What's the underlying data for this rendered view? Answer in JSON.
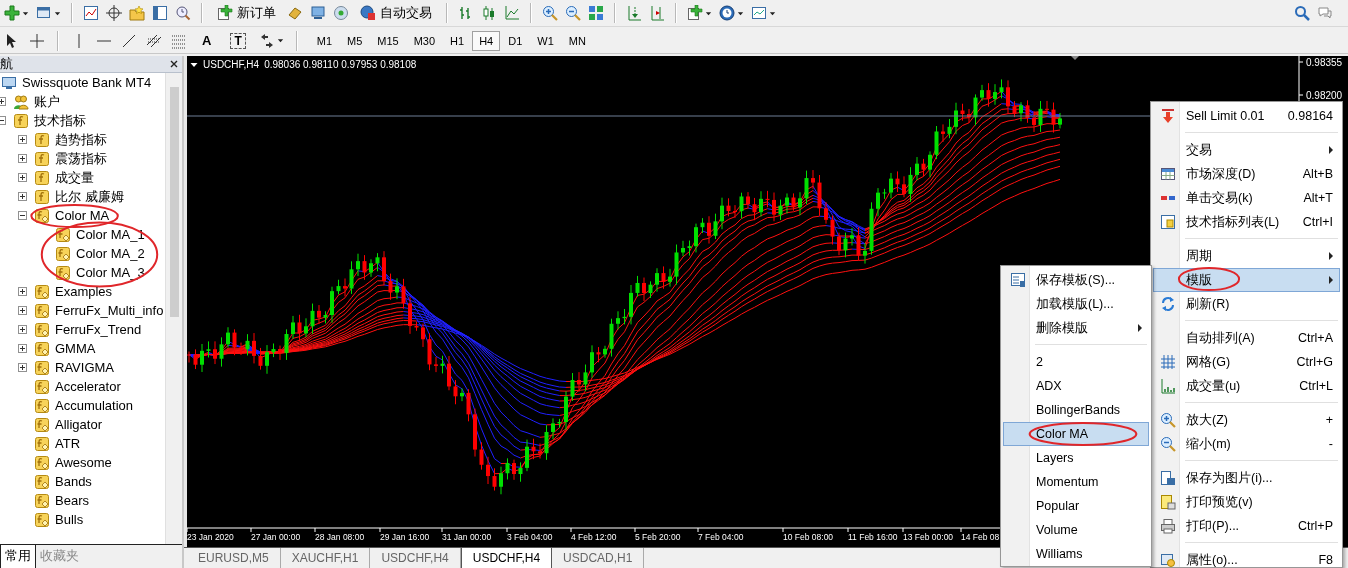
{
  "toolbar": {
    "new_order": "新订单",
    "auto_trading": "自动交易"
  },
  "drawing_toolbar": {
    "text_tool": "A",
    "label_tool": "T",
    "timeframes": [
      {
        "label": "M1",
        "selected": false
      },
      {
        "label": "M5",
        "selected": false
      },
      {
        "label": "M15",
        "selected": false
      },
      {
        "label": "M30",
        "selected": false
      },
      {
        "label": "H1",
        "selected": false
      },
      {
        "label": "H4",
        "selected": true
      },
      {
        "label": "D1",
        "selected": false
      },
      {
        "label": "W1",
        "selected": false
      },
      {
        "label": "MN",
        "selected": false
      }
    ]
  },
  "navigator": {
    "title": "航",
    "tree": [
      {
        "label": "Swissquote Bank MT4",
        "kind": "terminal",
        "circled": false,
        "children": [
          {
            "label": "账户",
            "kind": "accounts",
            "expanded": false,
            "circled": false
          },
          {
            "label": "技术指标",
            "kind": "folder",
            "expanded": true,
            "circled": false,
            "children": [
              {
                "label": "趋势指标",
                "kind": "folder",
                "expanded": false,
                "circled": false
              },
              {
                "label": "震荡指标",
                "kind": "folder",
                "expanded": false,
                "circled": false
              },
              {
                "label": "成交量",
                "kind": "folder",
                "expanded": false,
                "circled": false
              },
              {
                "label": "比尔 威廉姆",
                "kind": "folder",
                "expanded": false,
                "circled": false
              },
              {
                "label": "Color MA",
                "kind": "indicator",
                "expanded": true,
                "circled": true,
                "children_circled": true,
                "children": [
                  {
                    "label": "Color MA_1",
                    "kind": "indicator",
                    "circled": false
                  },
                  {
                    "label": "Color MA_2",
                    "kind": "indicator",
                    "circled": false
                  },
                  {
                    "label": "Color MA_3",
                    "kind": "indicator",
                    "circled": false
                  }
                ]
              },
              {
                "label": "Examples",
                "kind": "indicator",
                "expanded": false,
                "circled": false
              },
              {
                "label": "FerruFx_Multi_info",
                "kind": "indicator",
                "expanded": false,
                "circled": false
              },
              {
                "label": "FerruFx_Trend",
                "kind": "indicator",
                "expanded": false,
                "circled": false
              },
              {
                "label": "GMMA",
                "kind": "indicator",
                "expanded": false,
                "circled": false
              },
              {
                "label": "RAVIGMA",
                "kind": "indicator",
                "expanded": false,
                "circled": false
              },
              {
                "label": "Accelerator",
                "kind": "indicator",
                "circled": false
              },
              {
                "label": "Accumulation",
                "kind": "indicator",
                "circled": false
              },
              {
                "label": "Alligator",
                "kind": "indicator",
                "circled": false
              },
              {
                "label": "ATR",
                "kind": "indicator",
                "circled": false
              },
              {
                "label": "Awesome",
                "kind": "indicator",
                "circled": false
              },
              {
                "label": "Bands",
                "kind": "indicator",
                "circled": false
              },
              {
                "label": "Bears",
                "kind": "indicator",
                "circled": false
              },
              {
                "label": "Bulls",
                "kind": "indicator",
                "circled": false
              }
            ]
          }
        ]
      }
    ],
    "tabs": [
      {
        "label": "常用",
        "selected": true
      },
      {
        "label": "收藏夹",
        "selected": false
      }
    ]
  },
  "chart": {
    "symbol": "USDCHF,H4",
    "ohlc": "0.98036 0.98110 0.97953 0.98108",
    "price_labels": [
      "0.98355",
      "0.98200"
    ],
    "date_labels": [
      "23 Jan 2020",
      "27 Jan 00:00",
      "28 Jan 08:00",
      "29 Jan 16:00",
      "31 Jan 00:00",
      "3 Feb 04:00",
      "4 Feb 12:00",
      "5 Feb 20:00",
      "7 Feb 04:00",
      "10 Feb 08:00",
      "11 Feb 16:00",
      "13 Feb 00:00",
      "14 Feb 08"
    ]
  },
  "chart_tabs": [
    {
      "label": "EURUSD,M5",
      "selected": false
    },
    {
      "label": "XAUCHF,H1",
      "selected": false
    },
    {
      "label": "USDCHF,H4",
      "selected": false
    },
    {
      "label": "USDCHF,H4",
      "selected": true
    },
    {
      "label": "USDCAD,H1",
      "selected": false
    }
  ],
  "context_menu": {
    "items": [
      {
        "kind": "order",
        "label": "Sell Limit 0.01",
        "shortcut": "0.98164",
        "submenu": false,
        "selected": false,
        "circled": false
      },
      {
        "kind": "separator"
      },
      {
        "kind": "item",
        "label": "交易",
        "submenu": true,
        "selected": false,
        "circled": false
      },
      {
        "kind": "item",
        "label": "市场深度(D)",
        "shortcut": "Alt+B",
        "submenu": false,
        "selected": false,
        "circled": false
      },
      {
        "kind": "item",
        "label": "单击交易(k)",
        "shortcut": "Alt+T",
        "submenu": false,
        "selected": false,
        "circled": false
      },
      {
        "kind": "item",
        "label": "技术指标列表(L)",
        "shortcut": "Ctrl+I",
        "submenu": false,
        "selected": false,
        "circled": false
      },
      {
        "kind": "separator"
      },
      {
        "kind": "item",
        "label": "周期",
        "submenu": true,
        "selected": false,
        "circled": false
      },
      {
        "kind": "item",
        "label": "模版",
        "submenu": true,
        "selected": true,
        "circled": true
      },
      {
        "kind": "item",
        "label": "刷新(R)",
        "submenu": false,
        "selected": false,
        "circled": false
      },
      {
        "kind": "separator"
      },
      {
        "kind": "item",
        "label": "自动排列(A)",
        "shortcut": "Ctrl+A",
        "submenu": false,
        "selected": false,
        "circled": false
      },
      {
        "kind": "item",
        "label": "网格(G)",
        "shortcut": "Ctrl+G",
        "submenu": false,
        "selected": false,
        "circled": false
      },
      {
        "kind": "item",
        "label": "成交量(u)",
        "shortcut": "Ctrl+L",
        "submenu": false,
        "selected": false,
        "circled": false
      },
      {
        "kind": "separator"
      },
      {
        "kind": "item",
        "label": "放大(Z)",
        "shortcut": "+",
        "submenu": false,
        "selected": false,
        "circled": false
      },
      {
        "kind": "item",
        "label": "缩小(m)",
        "shortcut": "-",
        "submenu": false,
        "selected": false,
        "circled": false
      },
      {
        "kind": "separator"
      },
      {
        "kind": "item",
        "label": "保存为图片(i)...",
        "submenu": false,
        "selected": false,
        "circled": false
      },
      {
        "kind": "item",
        "label": "打印预览(v)",
        "submenu": false,
        "selected": false,
        "circled": false
      },
      {
        "kind": "item",
        "label": "打印(P)...",
        "shortcut": "Ctrl+P",
        "submenu": false,
        "selected": false,
        "circled": false
      },
      {
        "kind": "separator"
      },
      {
        "kind": "item",
        "label": "属性(o)...",
        "shortcut": "F8",
        "submenu": false,
        "selected": false,
        "circled": false
      }
    ]
  },
  "template_submenu": {
    "items": [
      {
        "kind": "item",
        "label": "保存模板(S)...",
        "submenu": false,
        "selected": false,
        "circled": false
      },
      {
        "kind": "item",
        "label": "加载模版(L)...",
        "submenu": false,
        "selected": false,
        "circled": false
      },
      {
        "kind": "item",
        "label": "删除模版",
        "submenu": true,
        "selected": false,
        "circled": false
      },
      {
        "kind": "separator"
      },
      {
        "kind": "item",
        "label": "2",
        "submenu": false,
        "selected": false,
        "circled": false
      },
      {
        "kind": "item",
        "label": "ADX",
        "submenu": false,
        "selected": false,
        "circled": false
      },
      {
        "kind": "item",
        "label": "BollingerBands",
        "submenu": false,
        "selected": false,
        "circled": false
      },
      {
        "kind": "item",
        "label": "Color MA",
        "submenu": false,
        "selected": true,
        "circled": true
      },
      {
        "kind": "item",
        "label": "Layers",
        "submenu": false,
        "selected": false,
        "circled": false
      },
      {
        "kind": "item",
        "label": "Momentum",
        "submenu": false,
        "selected": false,
        "circled": false
      },
      {
        "kind": "item",
        "label": "Popular",
        "submenu": false,
        "selected": false,
        "circled": false
      },
      {
        "kind": "item",
        "label": "Volume",
        "submenu": false,
        "selected": false,
        "circled": false
      },
      {
        "kind": "item",
        "label": "Williams",
        "submenu": false,
        "selected": false,
        "circled": false
      }
    ]
  }
}
